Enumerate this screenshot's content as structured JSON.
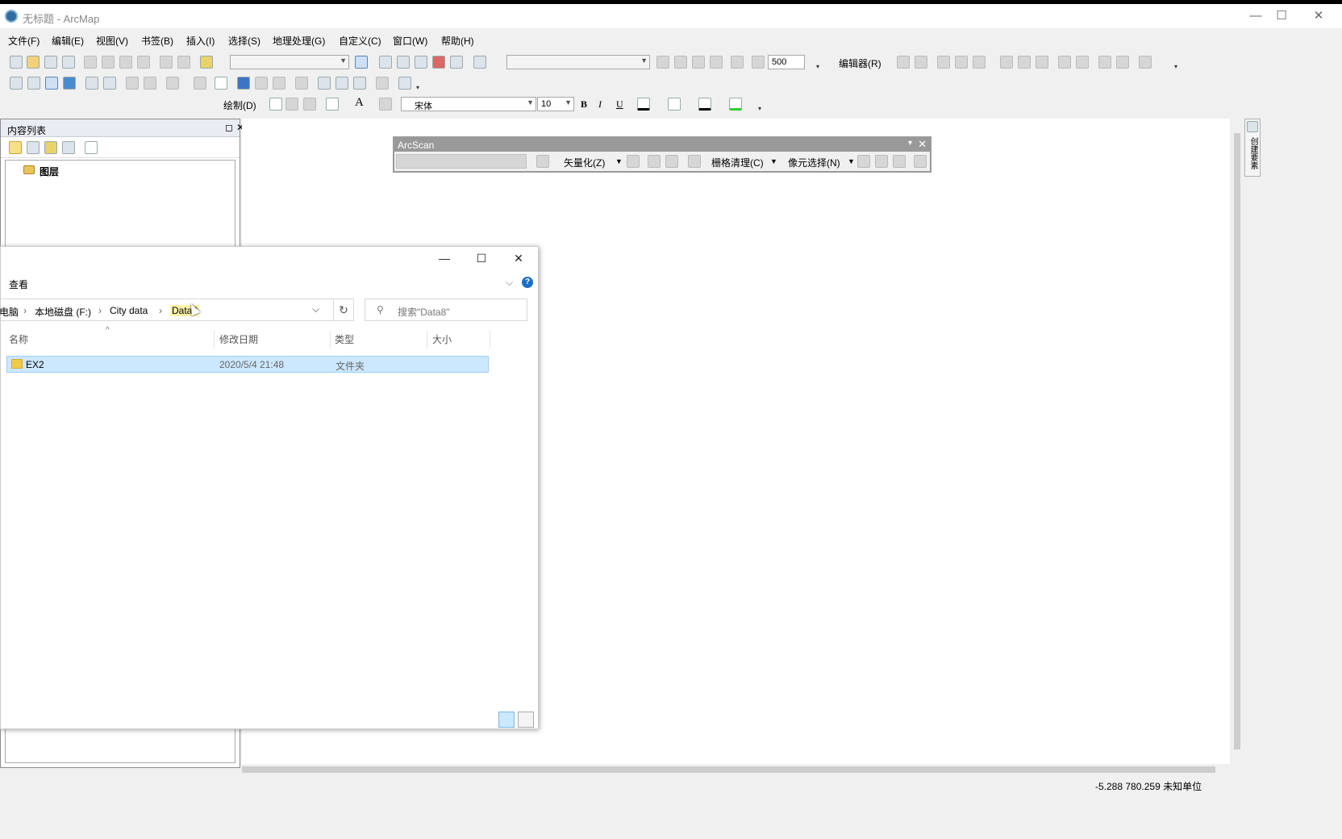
{
  "window": {
    "title": "无标题 - ArcMap",
    "controls": [
      "—",
      "☐",
      "✕"
    ]
  },
  "menu": [
    "文件(F)",
    "编辑(E)",
    "视图(V)",
    "书签(B)",
    "插入(I)",
    "选择(S)",
    "地理处理(G)",
    "自定义(C)",
    "窗口(W)",
    "帮助(H)"
  ],
  "standard_toolbar": {
    "scale_value": "500",
    "editor_label": "编辑器(R)"
  },
  "draw_toolbar": {
    "draw_label": "绘制(D)",
    "font_name": "宋体",
    "font_size": "10",
    "bold": "B",
    "italic": "I",
    "underline": "U",
    "text_tool": "A"
  },
  "toc": {
    "title": "内容列表",
    "layer_label": "图层"
  },
  "arcscan": {
    "title": "ArcScan",
    "vectorize_label": "矢量化(Z)",
    "raster_cleanup_label": "栅格清理(C)",
    "cell_select_label": "像元选择(N)"
  },
  "side_tab": {
    "label": "创建要素"
  },
  "dialog": {
    "ribbon_tab": "查看",
    "help_label": "?",
    "breadcrumb": [
      "电脑",
      "本地磁盘 (F:)",
      "City data",
      "Data8"
    ],
    "search_placeholder": "搜索\"Data8\"",
    "columns": [
      "名称",
      "修改日期",
      "类型",
      "大小"
    ],
    "rows": [
      {
        "name": "EX2",
        "modified": "2020/5/4 21:48",
        "type": "文件夹",
        "size": ""
      }
    ]
  },
  "status": {
    "coords": "-5.288  780.259 未知单位"
  },
  "colors": {
    "selection_bg": "#cce8ff",
    "arcscan_header": "#999999",
    "toc_header": "#e9edf3"
  }
}
